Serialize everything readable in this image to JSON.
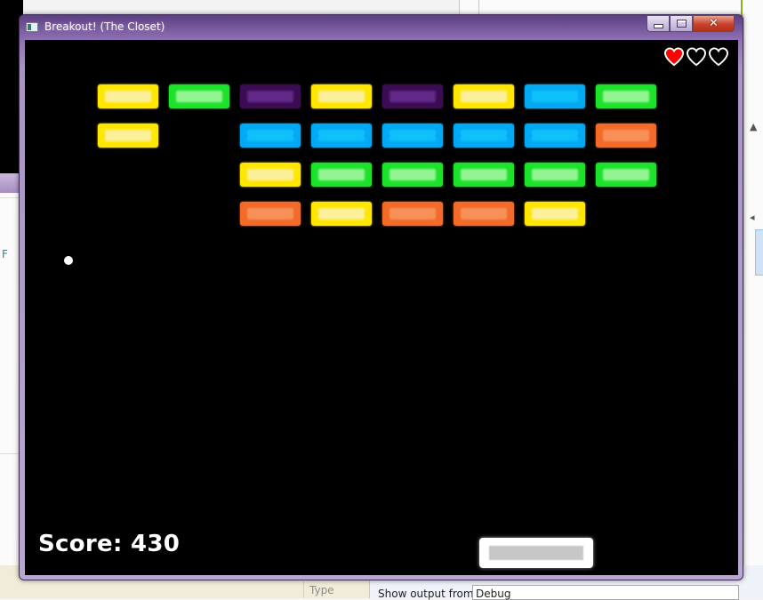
{
  "window": {
    "title": "Breakout! (The Closet)",
    "caption_minimize": "",
    "caption_maximize": "",
    "caption_close": "✕"
  },
  "background": {
    "left_panel_letter": "F",
    "table_header_type": "Type",
    "output_label": "Show output from:",
    "output_source": "Debug"
  },
  "game": {
    "score_label": "Score: 430",
    "score": 430,
    "lives_total": 3,
    "lives_remaining": 1,
    "heart_filled_color": "#ff0000",
    "heart_empty_color": "#ffffff",
    "brick_colors": {
      "yellow": {
        "outer": "#ffe600",
        "inner": "#fbef9a"
      },
      "green": {
        "outer": "#1de22c",
        "inner": "#93f591"
      },
      "purple": {
        "outer": "#3b0c52",
        "inner": "#62288a"
      },
      "blue": {
        "outer": "#04a9f4",
        "inner": "#0fc1fb"
      },
      "orange": {
        "outer": "#f46a29",
        "inner": "#f79159"
      }
    },
    "bricks": [
      [
        "yellow",
        "green",
        "purple",
        "yellow",
        "purple",
        "yellow",
        "blue",
        "green"
      ],
      [
        "yellow",
        null,
        "blue",
        "blue",
        "blue",
        "blue",
        "blue",
        "orange"
      ],
      [
        null,
        null,
        "yellow",
        "green",
        "green",
        "green",
        "green",
        "green"
      ],
      [
        null,
        null,
        "orange",
        "yellow",
        "orange",
        "orange",
        "yellow",
        null
      ]
    ]
  }
}
